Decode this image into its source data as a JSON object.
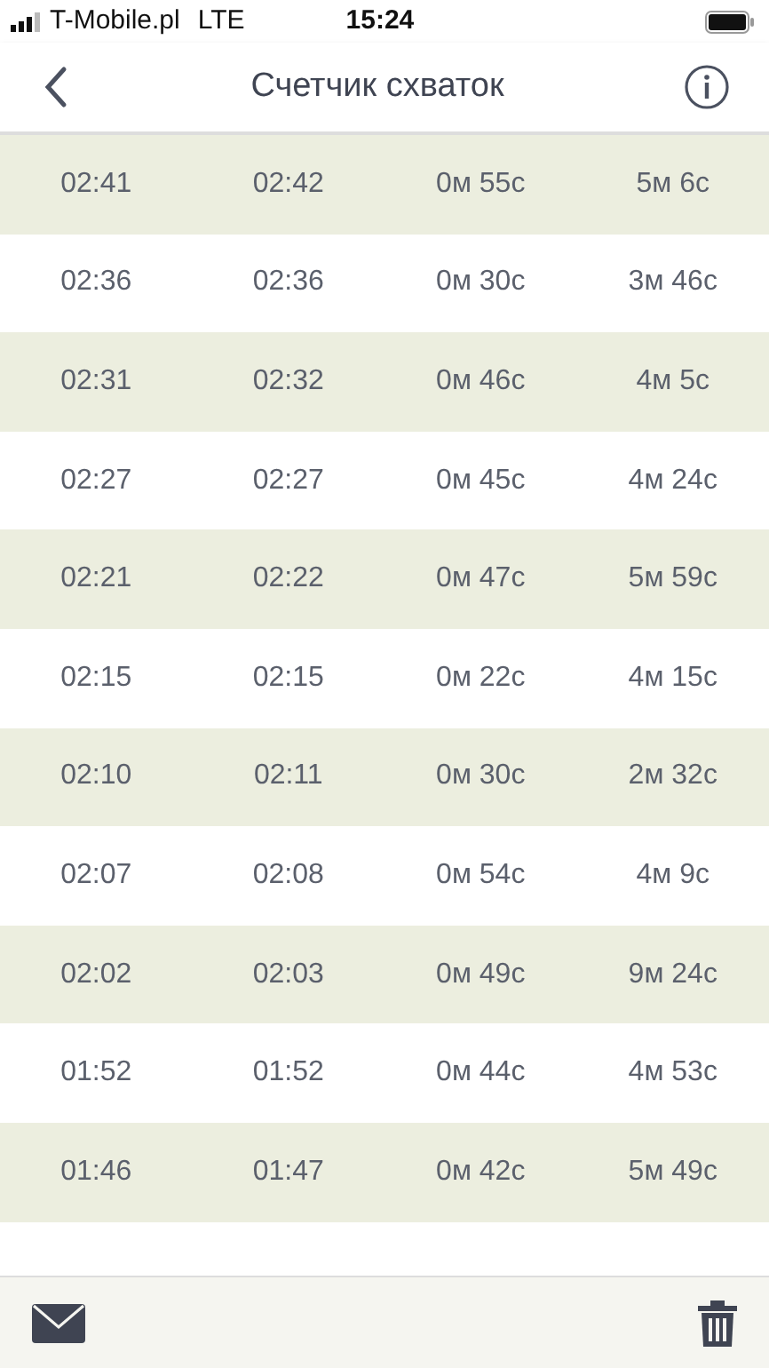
{
  "status_bar": {
    "carrier": "T-Mobile.pl",
    "network": "LTE",
    "time": "15:24"
  },
  "nav": {
    "title": "Счетчик схваток"
  },
  "rows": [
    {
      "cells": [
        "02:41",
        "02:42",
        "0м 55с",
        "5м 6с"
      ]
    },
    {
      "cells": [
        "02:36",
        "02:36",
        "0м 30с",
        "3м 46с"
      ]
    },
    {
      "cells": [
        "02:31",
        "02:32",
        "0м 46с",
        "4м 5с"
      ]
    },
    {
      "cells": [
        "02:27",
        "02:27",
        "0м 45с",
        "4м 24с"
      ]
    },
    {
      "cells": [
        "02:21",
        "02:22",
        "0м 47с",
        "5м 59с"
      ]
    },
    {
      "cells": [
        "02:15",
        "02:15",
        "0м 22с",
        "4м 15с"
      ]
    },
    {
      "cells": [
        "02:10",
        "02:11",
        "0м 30с",
        "2м 32с"
      ]
    },
    {
      "cells": [
        "02:07",
        "02:08",
        "0м 54с",
        "4м 9с"
      ]
    },
    {
      "cells": [
        "02:02",
        "02:03",
        "0м 49с",
        "9м 24с"
      ]
    },
    {
      "cells": [
        "01:52",
        "01:52",
        "0м 44с",
        "4м 53с"
      ]
    },
    {
      "cells": [
        "01:46",
        "01:47",
        "0м 42с",
        "5м 49с"
      ]
    }
  ]
}
